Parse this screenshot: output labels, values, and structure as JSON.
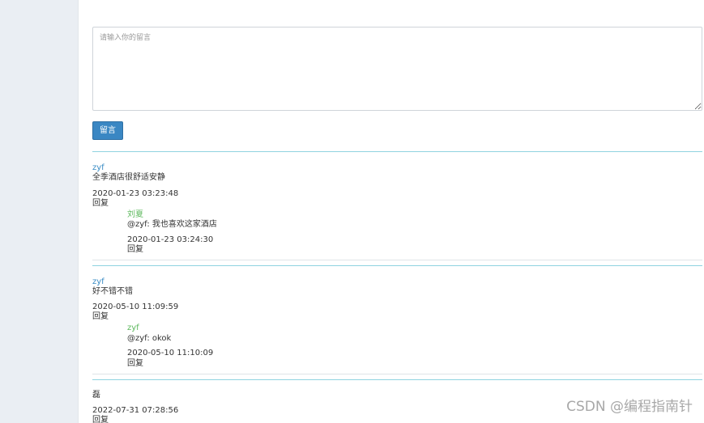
{
  "form": {
    "textarea_placeholder": "请输入你的留言",
    "submit_label": "留言"
  },
  "messages": [
    {
      "author": "zyf",
      "content": "全季酒店很舒适安静",
      "time": "2020-01-23 03:23:48",
      "reply_label": "回复",
      "replies": [
        {
          "author": "刘夏",
          "content": "@zyf:   我也喜欢这家酒店",
          "time": "2020-01-23 03:24:30",
          "reply_label": "回复"
        }
      ]
    },
    {
      "author": "zyf",
      "content": "好不错不错",
      "time": "2020-05-10 11:09:59",
      "reply_label": "回复",
      "replies": [
        {
          "author": "zyf",
          "content": "@zyf:   okok",
          "time": "2020-05-10 11:10:09",
          "reply_label": "回复"
        }
      ]
    },
    {
      "author": "",
      "content": "磊",
      "time": "2022-07-31 07:28:56",
      "reply_label": "回复",
      "replies": []
    }
  ],
  "watermark": "CSDN @编程指南针"
}
